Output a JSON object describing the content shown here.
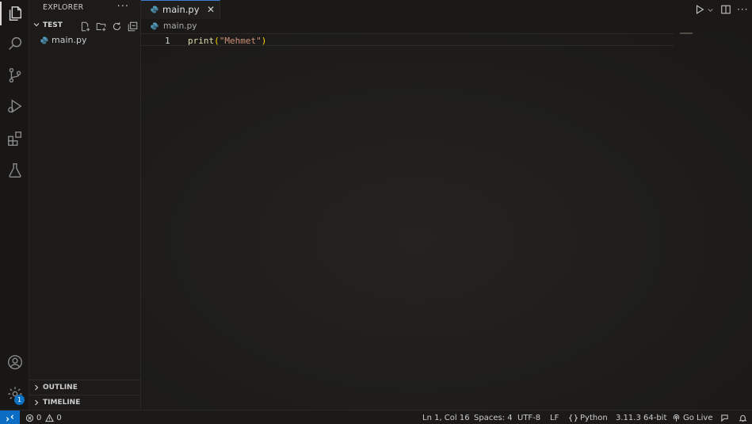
{
  "colors": {
    "accent": "#0a6cc2",
    "background": "#1a1918",
    "python_blue": "#519aba"
  },
  "activitybar": {
    "items": [
      {
        "name": "explorer-icon",
        "active": true
      },
      {
        "name": "search-icon"
      },
      {
        "name": "source-control-icon"
      },
      {
        "name": "run-debug-icon"
      },
      {
        "name": "extensions-icon"
      },
      {
        "name": "testing-icon"
      }
    ],
    "manage_badge": "1"
  },
  "sidebar": {
    "title": "EXPLORER",
    "more": "···",
    "folder_name": "TEST",
    "files": [
      {
        "name": "main.py",
        "icon": "python-file-icon"
      }
    ],
    "outline_label": "OUTLINE",
    "timeline_label": "TIMELINE"
  },
  "tabs": [
    {
      "label": "main.py",
      "icon": "python-file-icon",
      "active": true,
      "close": "✕"
    }
  ],
  "breadcrumb": {
    "file": "main.py"
  },
  "editor": {
    "lines": [
      {
        "number": "1",
        "tokens": [
          {
            "text": "print",
            "kind": "function"
          },
          {
            "text": "(",
            "kind": "bracket"
          },
          {
            "text": "\"Mehmet\"",
            "kind": "string"
          },
          {
            "text": ")",
            "kind": "bracket"
          }
        ]
      }
    ]
  },
  "statusbar": {
    "errors": "0",
    "warnings": "0",
    "position": "Ln 1, Col 16",
    "spaces": "Spaces: 4",
    "encoding": "UTF-8",
    "eol": "LF",
    "language": "Python",
    "interpreter": "3.11.3 64-bit",
    "golive": "Go Live"
  }
}
